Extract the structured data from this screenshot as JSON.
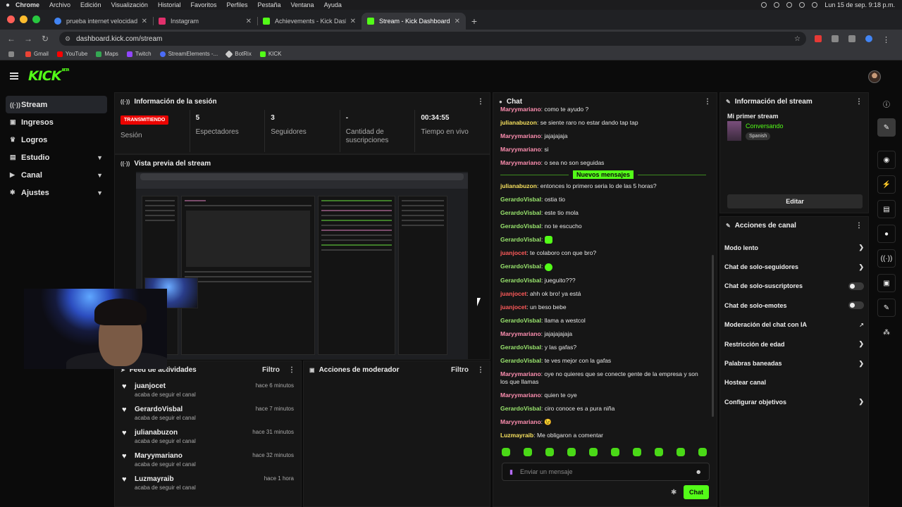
{
  "macos": {
    "app": "Chrome",
    "menus": [
      "Archivo",
      "Edición",
      "Visualización",
      "Historial",
      "Favoritos",
      "Perfiles",
      "Pestaña",
      "Ventana",
      "Ayuda"
    ],
    "clock": "Lun 15 de sep.  9:18 p.m."
  },
  "browser": {
    "tabs": [
      {
        "title": "prueba internet velocidad - B",
        "color": "#4285f4"
      },
      {
        "title": "Instagram",
        "color": "#e1306c"
      },
      {
        "title": "Achievements - Kick Dashbo",
        "color": "#53fc18"
      },
      {
        "title": "Stream - Kick Dashboard",
        "color": "#53fc18"
      }
    ],
    "url": "dashboard.kick.com/stream",
    "bookmarks": [
      {
        "label": "Gmail",
        "color": "#ea4335"
      },
      {
        "label": "YouTube",
        "color": "#ff0000"
      },
      {
        "label": "Maps",
        "color": "#34a853"
      },
      {
        "label": "Twitch",
        "color": "#9146ff"
      },
      {
        "label": "StreamElements -...",
        "color": "#4b6cf7"
      },
      {
        "label": "BotRix",
        "color": "#cccccc"
      },
      {
        "label": "KICK",
        "color": "#53fc18"
      }
    ]
  },
  "app": {
    "logo": "KICK",
    "beta": "BETA"
  },
  "sidebar": {
    "items": [
      {
        "label": "Stream",
        "icon": "broadcast-icon"
      },
      {
        "label": "Ingresos",
        "icon": "money-icon"
      },
      {
        "label": "Logros",
        "icon": "trophy-icon"
      },
      {
        "label": "Estudio",
        "icon": "studio-icon",
        "chevron": true
      },
      {
        "label": "Canal",
        "icon": "channel-icon",
        "chevron": true
      },
      {
        "label": "Ajustes",
        "icon": "gear-icon",
        "chevron": true
      }
    ]
  },
  "session": {
    "title": "Información de la sesión",
    "badge": "TRANSMITIENDO",
    "badge_label": "Sesión",
    "stats": [
      {
        "value": "5",
        "label": "Espectadores"
      },
      {
        "value": "3",
        "label": "Seguidores"
      },
      {
        "value": "-",
        "label": "Cantidad de suscripciones"
      },
      {
        "value": "00:34:55",
        "label": "Tiempo en vivo"
      }
    ]
  },
  "preview": {
    "title": "Vista previa del stream"
  },
  "feed": {
    "title": "Feed de actividades",
    "filter": "Filtro",
    "items": [
      {
        "user": "juanjocet",
        "action": "acaba de seguir el canal",
        "time": "hace 6 minutos"
      },
      {
        "user": "GerardoVisbal",
        "action": "acaba de seguir el canal",
        "time": "hace 7 minutos"
      },
      {
        "user": "julianabuzon",
        "action": "acaba de seguir el canal",
        "time": "hace 31 minutos"
      },
      {
        "user": "Maryymariano",
        "action": "acaba de seguir el canal",
        "time": "hace 32 minutos"
      },
      {
        "user": "Luzmayraib",
        "action": "acaba de seguir el canal",
        "time": "hace 1 hora"
      }
    ]
  },
  "moderator": {
    "title": "Acciones de moderador",
    "filter": "Filtro"
  },
  "chat": {
    "title": "Chat",
    "separator": "Nuevos mensajes",
    "messages_before": [
      {
        "user": "Maryymariano",
        "text": "como te ayudo ?",
        "color": "#ff8fb1"
      },
      {
        "user": "julianabuzon",
        "text": "se siente raro no estar dando tap tap",
        "color": "#f6e05e"
      },
      {
        "user": "Maryymariano",
        "text": "jajajajaja",
        "color": "#ff8fb1"
      },
      {
        "user": "Maryymariano",
        "text": "si",
        "color": "#ff8fb1"
      },
      {
        "user": "Maryymariano",
        "text": "o sea no son seguidas",
        "color": "#ff8fb1"
      }
    ],
    "messages_after": [
      {
        "user": "julianabuzon",
        "text": "entonces lo primero seria lo de las 5 horas?",
        "color": "#f6e05e"
      },
      {
        "user": "GerardoVisbal",
        "text": "ostia tio",
        "color": "#9ae66e"
      },
      {
        "user": "GerardoVisbal",
        "text": "este tio mola",
        "color": "#9ae66e"
      },
      {
        "user": "GerardoVisbal",
        "text": "no te escucho",
        "color": "#9ae66e"
      },
      {
        "user": "GerardoVisbal",
        "text": "",
        "emote": true,
        "color": "#9ae66e"
      },
      {
        "user": "juanjocet",
        "text": "te colaboro con que bro?",
        "color": "#ff5a5a"
      },
      {
        "user": "GerardoVisbal",
        "text": "",
        "emote": true,
        "color": "#9ae66e"
      },
      {
        "user": "GerardoVisbal",
        "text": "jueguito???",
        "color": "#9ae66e"
      },
      {
        "user": "juanjocet",
        "text": "ahh ok bro! ya está",
        "color": "#ff5a5a"
      },
      {
        "user": "juanjocet",
        "text": "un beso bebe",
        "color": "#ff5a5a"
      },
      {
        "user": "GerardoVisbal",
        "text": "llama a westcol",
        "color": "#9ae66e"
      },
      {
        "user": "Maryymariano",
        "text": "jajajajajaja",
        "color": "#ff8fb1"
      },
      {
        "user": "GerardoVisbal",
        "text": "y las gafas?",
        "color": "#9ae66e"
      },
      {
        "user": "GerardoVisbal",
        "text": "te ves mejor con la gafas",
        "color": "#9ae66e"
      },
      {
        "user": "Maryymariano",
        "text": "oye no quieres que se conecte gente de la empresa y son los que llamas",
        "color": "#ff8fb1"
      },
      {
        "user": "Maryymariano",
        "text": "quien te oye",
        "color": "#ff8fb1"
      },
      {
        "user": "GerardoVisbal",
        "text": "ciro conoce es a pura niña",
        "color": "#9ae66e"
      },
      {
        "user": "Maryymariano",
        "text": "😉",
        "color": "#ff8fb1"
      },
      {
        "user": "Luzmayraib",
        "text": "Me obligaron a comentar",
        "color": "#f6e05e"
      }
    ],
    "input_placeholder": "Enviar un mensaje",
    "send_label": "Chat"
  },
  "stream_info": {
    "title": "Información del stream",
    "stream_title": "Mi primer stream",
    "category": "Conversando",
    "language": "Spanish",
    "edit_label": "Editar"
  },
  "channel_actions": {
    "title": "Acciones de canal",
    "items": [
      {
        "label": "Modo lento",
        "control": "chevron"
      },
      {
        "label": "Chat de solo-seguidores",
        "control": "chevron"
      },
      {
        "label": "Chat de solo-suscriptores",
        "control": "toggle"
      },
      {
        "label": "Chat de solo-emotes",
        "control": "toggle"
      },
      {
        "label": "Moderación del chat con IA",
        "control": "external"
      },
      {
        "label": "Restricción de edad",
        "control": "chevron"
      },
      {
        "label": "Palabras baneadas",
        "control": "chevron"
      },
      {
        "label": "Hostear canal",
        "control": "none"
      },
      {
        "label": "Configurar objetivos",
        "control": "chevron"
      }
    ]
  },
  "colors": {
    "accent": "#53fc18",
    "live": "#eb0400"
  }
}
